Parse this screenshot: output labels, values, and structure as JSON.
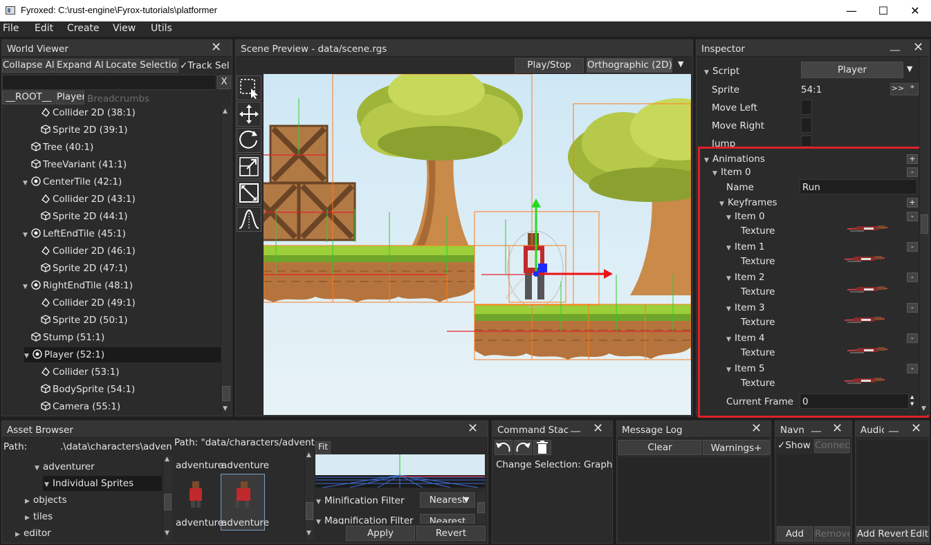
{
  "window": {
    "title": "Fyroxed: C:\\rust-engine\\Fyrox-tutorials\\platformer",
    "minimize": "—",
    "maximize": "☐",
    "close": "✕"
  },
  "menu": [
    "File",
    "Edit",
    "Create",
    "View",
    "Utils"
  ],
  "world_viewer": {
    "title": "World Viewer",
    "buttons": [
      "Collapse All",
      "Expand All",
      "Locate Selection"
    ],
    "track_label": "Track Sel",
    "search_value": "",
    "clear": "X",
    "breadcrumbs": [
      "__ROOT__",
      "Player"
    ],
    "breadcrumbs_placeholder": "Breadcrumbs",
    "items": [
      {
        "label": "Collider 2D (38:1)",
        "indent": 2,
        "icon": "collider",
        "expander": false
      },
      {
        "label": "Sprite 2D (39:1)",
        "indent": 2,
        "icon": "cube",
        "expander": false
      },
      {
        "label": "Tree (40:1)",
        "indent": 1,
        "icon": "cube",
        "expander": false
      },
      {
        "label": "TreeVariant (41:1)",
        "indent": 1,
        "icon": "cube",
        "expander": false
      },
      {
        "label": "CenterTile (42:1)",
        "indent": 1,
        "icon": "pivot",
        "expander": true
      },
      {
        "label": "Collider 2D (43:1)",
        "indent": 2,
        "icon": "collider",
        "expander": false
      },
      {
        "label": "Sprite 2D (44:1)",
        "indent": 2,
        "icon": "cube",
        "expander": false
      },
      {
        "label": "LeftEndTile (45:1)",
        "indent": 1,
        "icon": "pivot",
        "expander": true
      },
      {
        "label": "Collider 2D (46:1)",
        "indent": 2,
        "icon": "collider",
        "expander": false
      },
      {
        "label": "Sprite 2D (47:1)",
        "indent": 2,
        "icon": "cube",
        "expander": false
      },
      {
        "label": "RightEndTile (48:1)",
        "indent": 1,
        "icon": "pivot",
        "expander": true
      },
      {
        "label": "Collider 2D (49:1)",
        "indent": 2,
        "icon": "collider",
        "expander": false
      },
      {
        "label": "Sprite 2D (50:1)",
        "indent": 2,
        "icon": "cube",
        "expander": false
      },
      {
        "label": "Stump (51:1)",
        "indent": 1,
        "icon": "cube",
        "expander": false
      },
      {
        "label": "Player (52:1)",
        "indent": 1,
        "icon": "pivot",
        "expander": true,
        "selected": true
      },
      {
        "label": "Collider (53:1)",
        "indent": 2,
        "icon": "collider",
        "expander": false
      },
      {
        "label": "BodySprite (54:1)",
        "indent": 2,
        "icon": "cube",
        "expander": false
      },
      {
        "label": "Camera (55:1)",
        "indent": 2,
        "icon": "cube",
        "expander": false
      }
    ]
  },
  "scene_preview": {
    "title": "Scene Preview - data/scene.rgs",
    "play_stop": "Play/Stop",
    "projection": "Orthographic (2D)",
    "tools": [
      "select-icon",
      "move-icon",
      "rotate-icon",
      "scale-icon",
      "resize-icon",
      "curve-icon"
    ]
  },
  "inspector": {
    "title": "Inspector",
    "script_label": "Script",
    "script_value": "Player",
    "sprite_label": "Sprite",
    "sprite_value": "54:1",
    "sprite_btn1": ">>",
    "sprite_btn2": "*",
    "move_left": "Move Left",
    "move_right": "Move Right",
    "jump": "Jump",
    "animations": "Animations",
    "item0": "Item 0",
    "name_label": "Name",
    "name_value": "Run",
    "keyframes": "Keyframes",
    "keyframe_items": [
      "Item 0",
      "Item 1",
      "Item 2",
      "Item 3",
      "Item 4",
      "Item 5"
    ],
    "texture_label": "Texture",
    "current_frame_label": "Current Frame",
    "current_frame_value": "0",
    "plus": "+",
    "minus": "-"
  },
  "asset_browser": {
    "title": "Asset Browser",
    "path_label": "Path:",
    "path_value": ".\\data\\characters\\adventur",
    "path_right": "Path: \"data/characters/adventure",
    "tree": [
      {
        "label": "adventurer",
        "indent": 1,
        "expanded": true
      },
      {
        "label": "Individual Sprites",
        "indent": 2,
        "expanded": true,
        "selected": true
      },
      {
        "label": "objects",
        "indent": 0,
        "expanded": false
      },
      {
        "label": "tiles",
        "indent": 0,
        "expanded": false
      },
      {
        "label": "editor",
        "indent": -1,
        "expanded": false
      }
    ],
    "files_top": [
      "adventure",
      "adventure"
    ],
    "files_bottom": [
      "adventure",
      "adventure"
    ],
    "fit": "Fit",
    "minification_label": "Minification Filter",
    "minification_value": "Nearest",
    "magnification_label": "Magnification Filter",
    "magnification_value": "Nearest",
    "apply": "Apply",
    "revert": "Revert"
  },
  "command_stack": {
    "title": "Command Stac",
    "entry": "Change Selection: Graph"
  },
  "message_log": {
    "title": "Message Log",
    "clear": "Clear",
    "warnings": "Warnings+"
  },
  "navmesh": {
    "title": "Navn",
    "show": "Show",
    "connect": "Connect",
    "add": "Add",
    "remove": "Remove"
  },
  "audio": {
    "title": "Audic",
    "add_reverb": "Add Reverb",
    "edit": "Edit"
  },
  "colors": {
    "highlight": "#e0202a",
    "accent_green": "#2ecc2e"
  }
}
